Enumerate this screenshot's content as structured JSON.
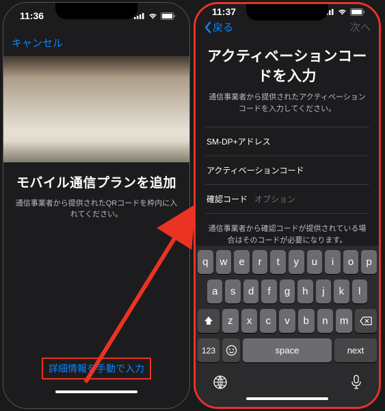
{
  "left": {
    "time": "11:36",
    "cancel": "キャンセル",
    "title": "モバイル通信プランを追加",
    "subtitle": "通信事業者から提供されたQRコードを枠内に入れてください。",
    "manual_link": "詳細情報を手動で入力"
  },
  "right": {
    "time": "11:37",
    "back": "戻る",
    "next": "次へ",
    "title_line1": "アクティベーションコー",
    "title_line2": "ドを入力",
    "subtitle": "通信事業者から提供されたアクティベーションコードを入力してください。",
    "fields": {
      "smdp": "SM-DP+アドレス",
      "activation": "アクティベーションコード",
      "confirm_label": "確認コード",
      "confirm_placeholder": "オプション"
    },
    "note": "通信事業者から確認コードが提供されている場合はそのコードが必要になります。"
  },
  "keyboard": {
    "row1": [
      "q",
      "w",
      "e",
      "r",
      "t",
      "y",
      "u",
      "i",
      "o",
      "p"
    ],
    "row2": [
      "a",
      "s",
      "d",
      "f",
      "g",
      "h",
      "j",
      "k",
      "l"
    ],
    "row3": [
      "z",
      "x",
      "c",
      "v",
      "b",
      "n",
      "m"
    ],
    "num": "123",
    "space": "space",
    "next": "next"
  }
}
